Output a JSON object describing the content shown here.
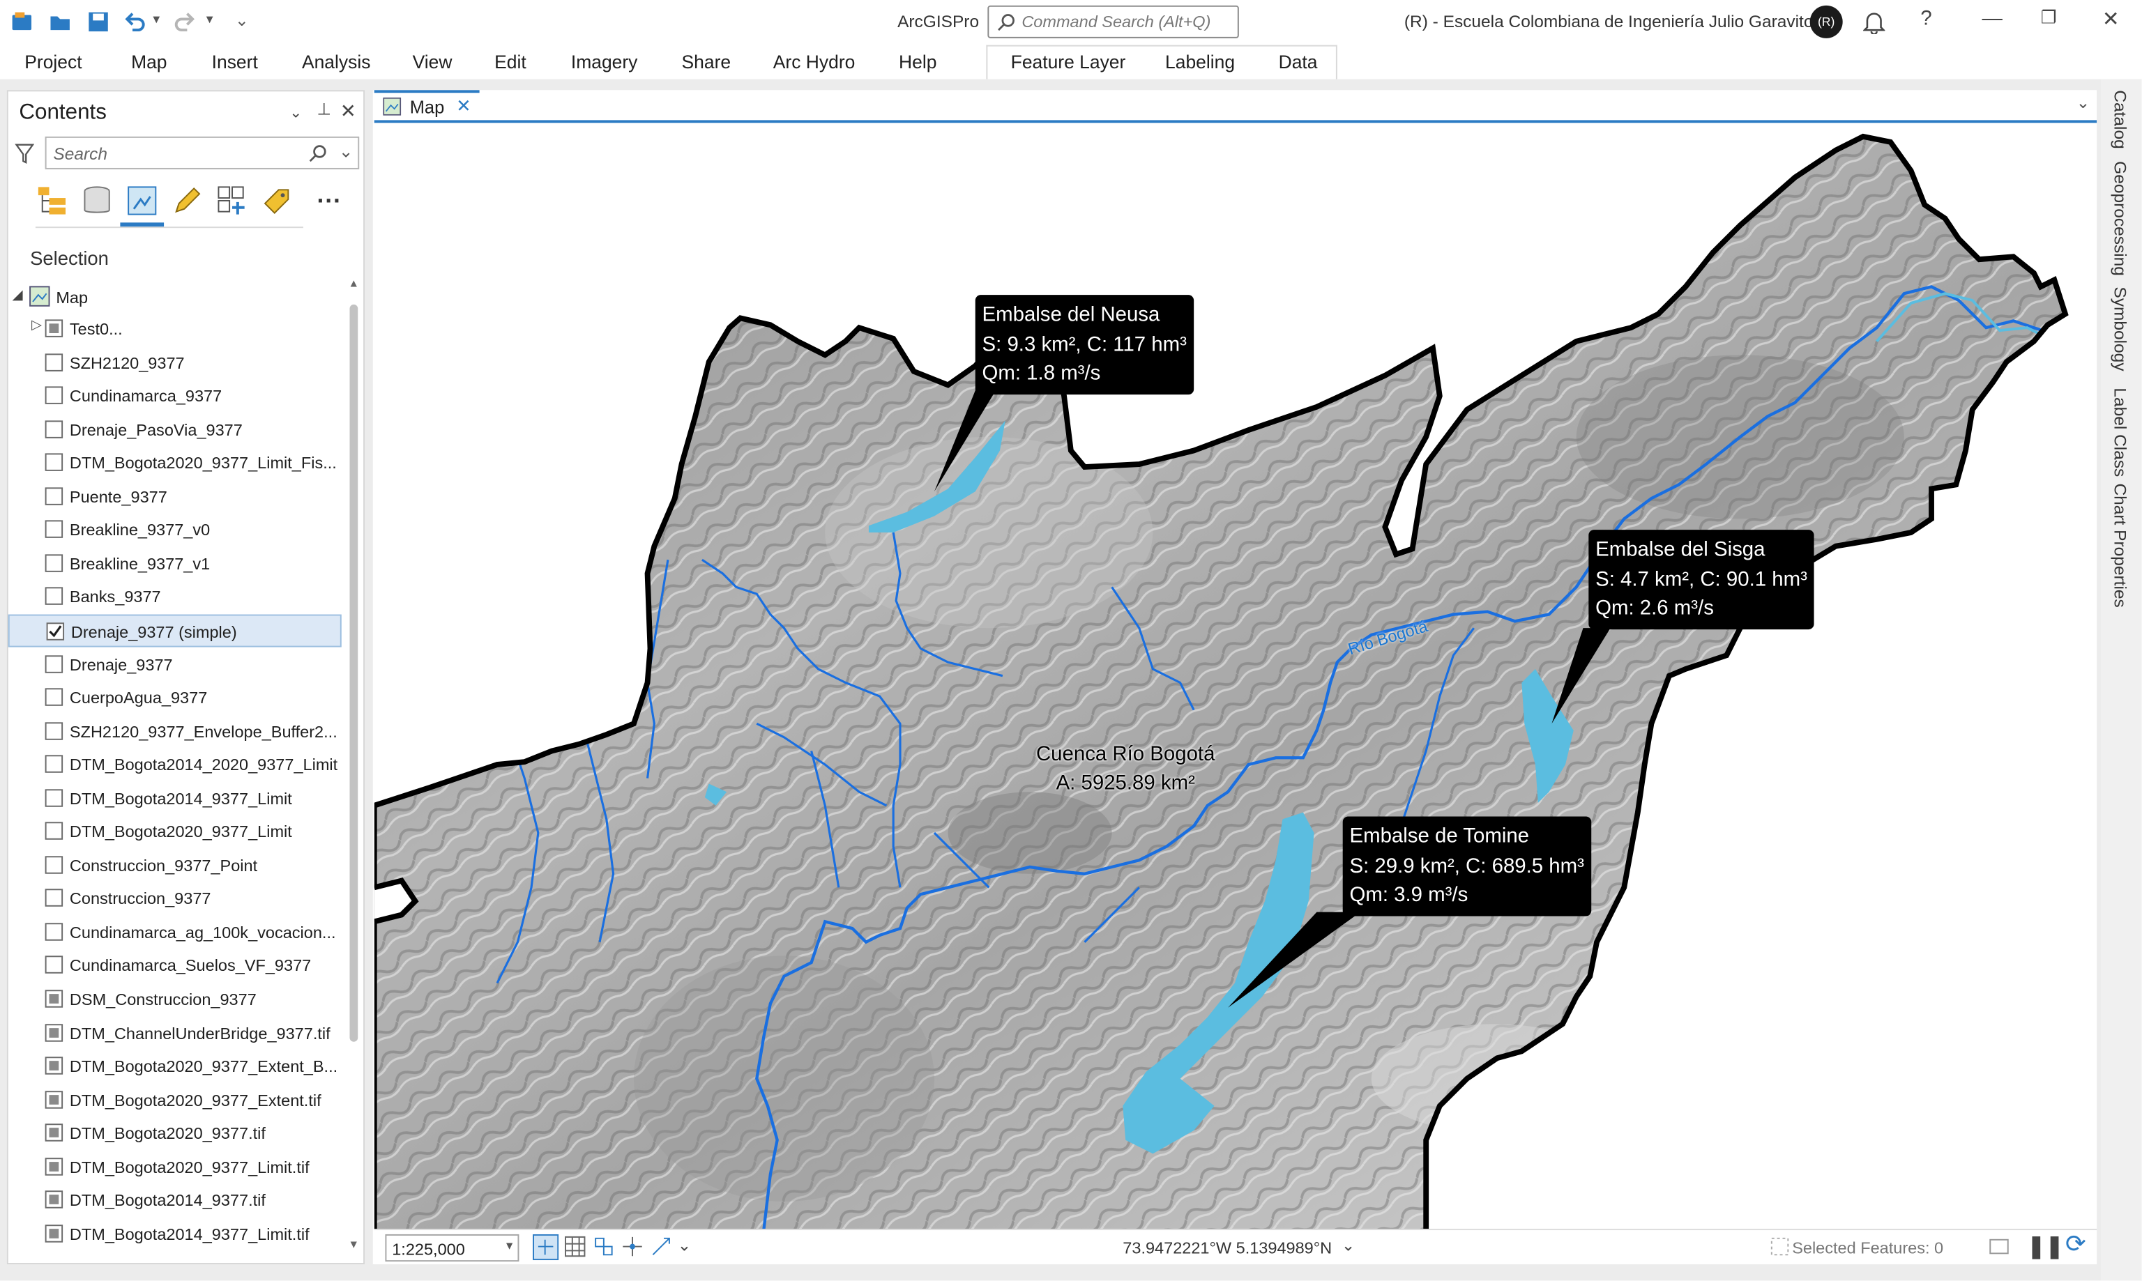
{
  "app": {
    "title": "ArcGISPro",
    "command_search_placeholder": "Command Search (Alt+Q)",
    "org": "(R)  -  Escuela Colombiana de Ingeniería Julio Garavito",
    "avatar_initials": "(R)"
  },
  "menu": [
    "Project",
    "Map",
    "Insert",
    "Analysis",
    "View",
    "Edit",
    "Imagery",
    "Share",
    "Arc Hydro",
    "Help"
  ],
  "context_menu": [
    "Feature Layer",
    "Labeling",
    "Data"
  ],
  "contents": {
    "title": "Contents",
    "search_placeholder": "Search",
    "section": "Selection",
    "map_root": "Map",
    "layers": [
      {
        "name": "Test0...",
        "state": "group"
      },
      {
        "name": "SZH2120_9377",
        "state": "off"
      },
      {
        "name": "Cundinamarca_9377",
        "state": "off"
      },
      {
        "name": "Drenaje_PasoVia_9377",
        "state": "off"
      },
      {
        "name": "DTM_Bogota2020_9377_Limit_Fis...",
        "state": "off"
      },
      {
        "name": "Puente_9377",
        "state": "off"
      },
      {
        "name": "Breakline_9377_v0",
        "state": "off"
      },
      {
        "name": "Breakline_9377_v1",
        "state": "off"
      },
      {
        "name": "Banks_9377",
        "state": "off"
      },
      {
        "name": "Drenaje_9377 (simple)",
        "state": "on"
      },
      {
        "name": "Drenaje_9377",
        "state": "off"
      },
      {
        "name": "CuerpoAgua_9377",
        "state": "off"
      },
      {
        "name": "SZH2120_9377_Envelope_Buffer2...",
        "state": "off"
      },
      {
        "name": "DTM_Bogota2014_2020_9377_Limit",
        "state": "off"
      },
      {
        "name": "DTM_Bogota2014_9377_Limit",
        "state": "off"
      },
      {
        "name": "DTM_Bogota2020_9377_Limit",
        "state": "off"
      },
      {
        "name": "Construccion_9377_Point",
        "state": "off"
      },
      {
        "name": "Construccion_9377",
        "state": "off"
      },
      {
        "name": "Cundinamarca_ag_100k_vocacion...",
        "state": "off"
      },
      {
        "name": "Cundinamarca_Suelos_VF_9377",
        "state": "off"
      },
      {
        "name": "DSM_Construccion_9377",
        "state": "raster"
      },
      {
        "name": "DTM_ChannelUnderBridge_9377.tif",
        "state": "raster"
      },
      {
        "name": "DTM_Bogota2020_9377_Extent_B...",
        "state": "raster"
      },
      {
        "name": "DTM_Bogota2020_9377_Extent.tif",
        "state": "raster"
      },
      {
        "name": "DTM_Bogota2020_9377.tif",
        "state": "raster"
      },
      {
        "name": "DTM_Bogota2020_9377_Limit.tif",
        "state": "raster"
      },
      {
        "name": "DTM_Bogota2014_9377.tif",
        "state": "raster"
      },
      {
        "name": "DTM_Bogota2014_9377_Limit.tif",
        "state": "raster"
      }
    ]
  },
  "map": {
    "tab": "Map",
    "callouts": {
      "neusa": {
        "title": "Embalse del Neusa",
        "line1": "S: 9.3 km², C: 117 hm³",
        "line2": "Qm: 1.8 m³/s"
      },
      "sisga": {
        "title": "Embalse del Sisga",
        "line1": "S: 4.7 km², C: 90.1 hm³",
        "line2": "Qm: 2.6 m³/s"
      },
      "tomine": {
        "title": "Embalse de Tomine",
        "line1": "S: 29.9 km², C: 689.5 hm³",
        "line2": "Qm: 3.9 m³/s"
      }
    },
    "basin_label": "Cuenca Río Bogotá",
    "basin_area": "A: 5925.89 km²",
    "river_label": "Río Bogotá"
  },
  "status": {
    "scale": "1:225,000",
    "coordinates": "73.9472221°W 5.1394989°N",
    "selected_features": "Selected Features: 0"
  },
  "right_tabs": [
    "Catalog",
    "Geoprocessing",
    "Symbology",
    "Label Class",
    "Chart Properties"
  ],
  "colors": {
    "accent": "#2b7bc4",
    "water": "#5bbde0",
    "river": "#1a6fe0"
  }
}
